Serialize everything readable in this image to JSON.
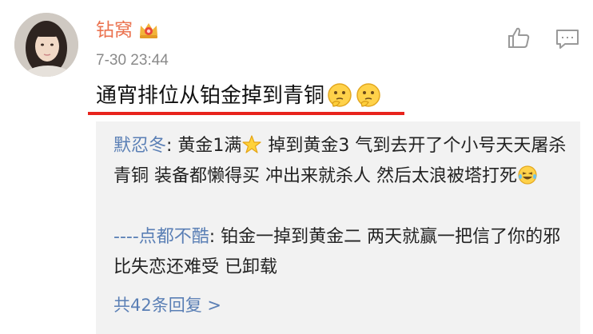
{
  "comment": {
    "username": "钻窝",
    "timestamp": "7-30 23:44",
    "text": "通宵排位从铂金掉到青铜"
  },
  "icons": {
    "badge": "crown-badge-icon",
    "like": "thumbs-up-icon",
    "reply": "comment-bubble-icon",
    "emoji": "thinking-face-icon",
    "star": "star-emoji-icon",
    "laugh": "laughing-tears-emoji-icon"
  },
  "replies": [
    {
      "name": "默忍冬",
      "sep": ": ",
      "part1": "黄金1满",
      "part2": " 掉到黄金3 气到去开了个小号天天屠杀青铜 装备都懒得买 冲出来就杀人 然后太浪被塔打死"
    },
    {
      "name": "----点都不酷",
      "sep": ": ",
      "text": "铂金一掉到黄金二  两天就赢一把信了你的邪 比失恋还难受 已卸载"
    }
  ],
  "more_replies": "共42条回复 >",
  "colors": {
    "username": "#eb7350",
    "link": "#5a7fb5",
    "highlight_underline": "#e8231c",
    "reply_background": "#f2f2f2"
  }
}
